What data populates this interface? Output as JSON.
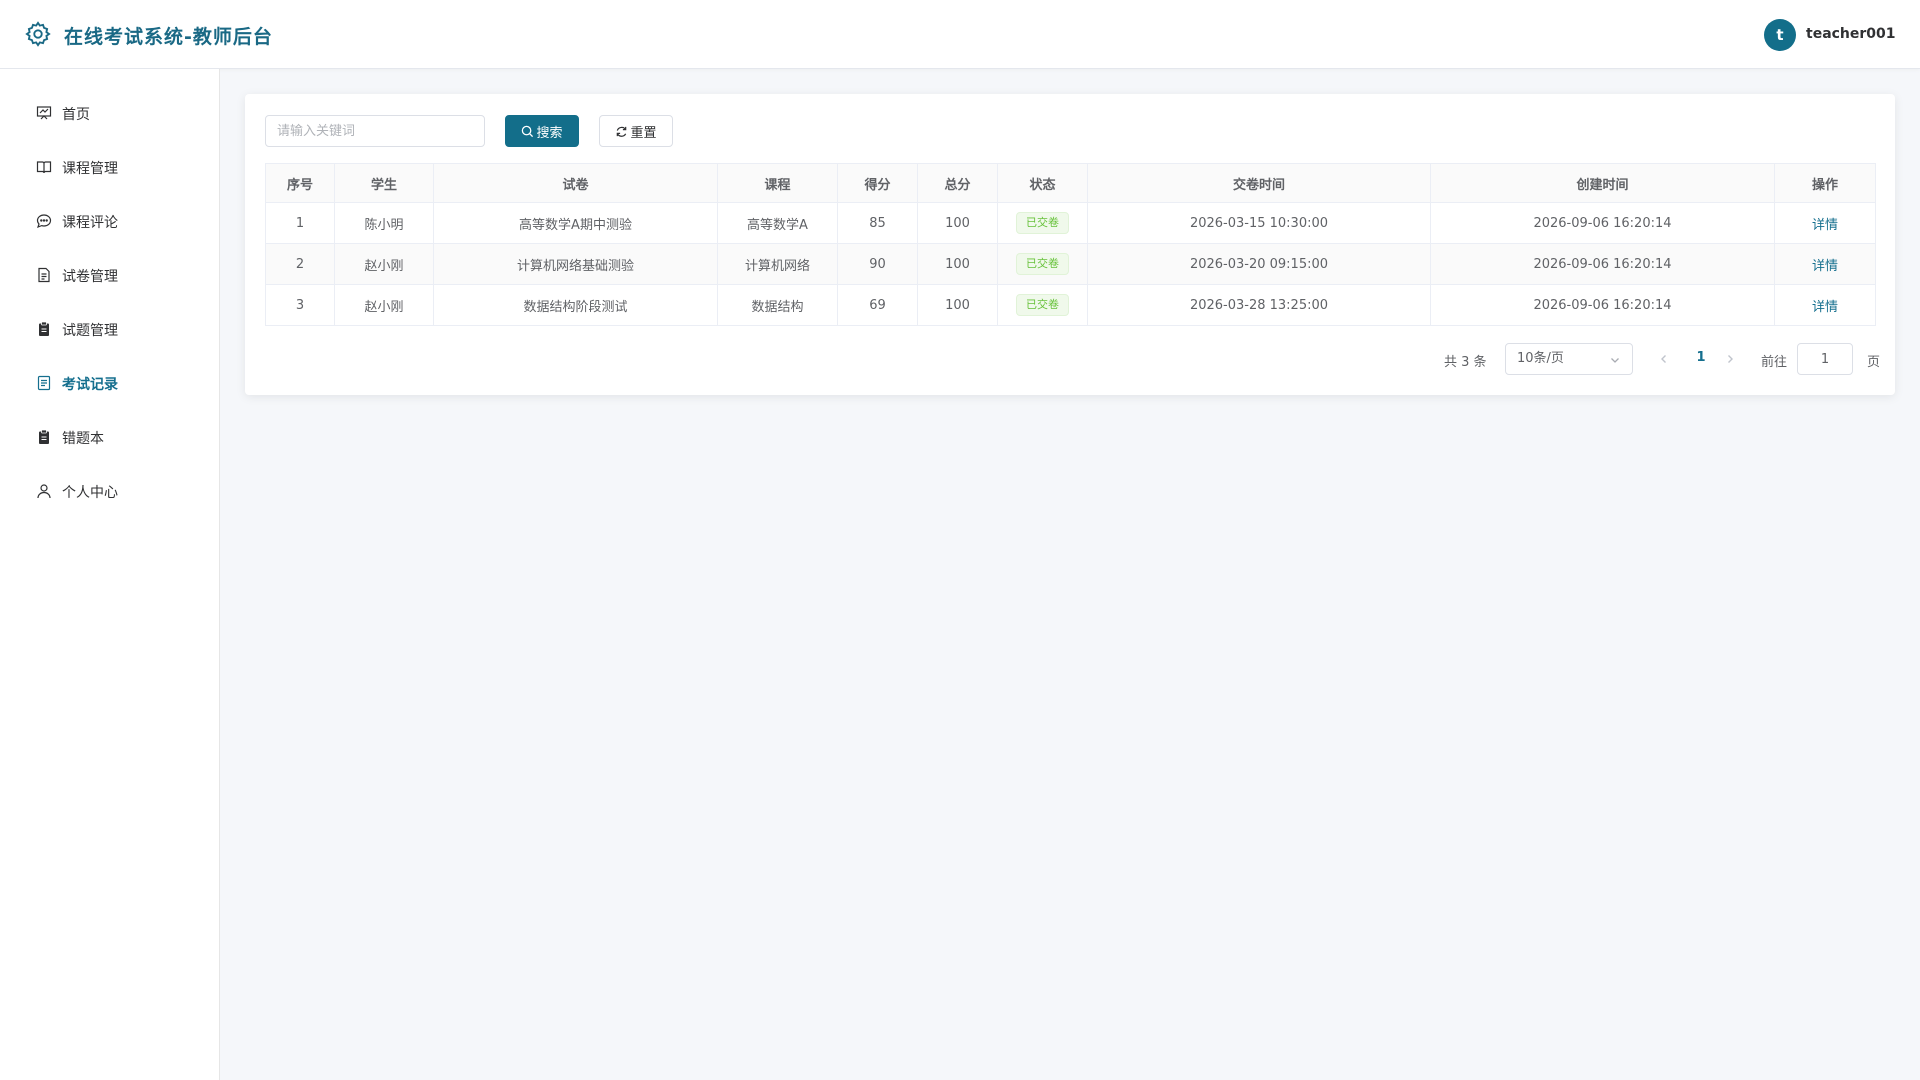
{
  "header": {
    "app_title": "在线考试系统-教师后台",
    "avatar_letter": "t",
    "username": "teacher001",
    "brand_color": "#136e8a"
  },
  "sidebar": {
    "items": [
      {
        "label": "首页",
        "icon": "dashboard-icon",
        "active": false
      },
      {
        "label": "课程管理",
        "icon": "book-icon",
        "active": false
      },
      {
        "label": "课程评论",
        "icon": "chat-icon",
        "active": false
      },
      {
        "label": "试卷管理",
        "icon": "document-icon",
        "active": false
      },
      {
        "label": "试题管理",
        "icon": "clipboard-icon",
        "active": false
      },
      {
        "label": "考试记录",
        "icon": "record-icon",
        "active": true
      },
      {
        "label": "错题本",
        "icon": "clipboard-icon",
        "active": false
      },
      {
        "label": "个人中心",
        "icon": "user-icon",
        "active": false
      }
    ]
  },
  "toolbar": {
    "search_placeholder": "请输入关键词",
    "search_value": "",
    "search_label": "搜索",
    "reset_label": "重置"
  },
  "table": {
    "columns": [
      "序号",
      "学生",
      "试卷",
      "课程",
      "得分",
      "总分",
      "状态",
      "交卷时间",
      "创建时间",
      "操作"
    ],
    "rows": [
      {
        "index": "1",
        "student": "陈小明",
        "paper": "高等数学A期中测验",
        "course": "高等数学A",
        "score": "85",
        "total": "100",
        "status": "已交卷",
        "submit_time": "2026-03-15 10:30:00",
        "create_time": "2026-09-06 16:20:14",
        "action": "详情"
      },
      {
        "index": "2",
        "student": "赵小刚",
        "paper": "计算机网络基础测验",
        "course": "计算机网络",
        "score": "90",
        "total": "100",
        "status": "已交卷",
        "submit_time": "2026-03-20 09:15:00",
        "create_time": "2026-09-06 16:20:14",
        "action": "详情"
      },
      {
        "index": "3",
        "student": "赵小刚",
        "paper": "数据结构阶段测试",
        "course": "数据结构",
        "score": "69",
        "total": "100",
        "status": "已交卷",
        "submit_time": "2026-03-28 13:25:00",
        "create_time": "2026-09-06 16:20:14",
        "action": "详情"
      }
    ]
  },
  "pagination": {
    "total_text": "共 3 条",
    "page_size": "10条/页",
    "current_page": "1",
    "goto_label": "前往",
    "goto_value": "1",
    "page_suffix": "页"
  }
}
